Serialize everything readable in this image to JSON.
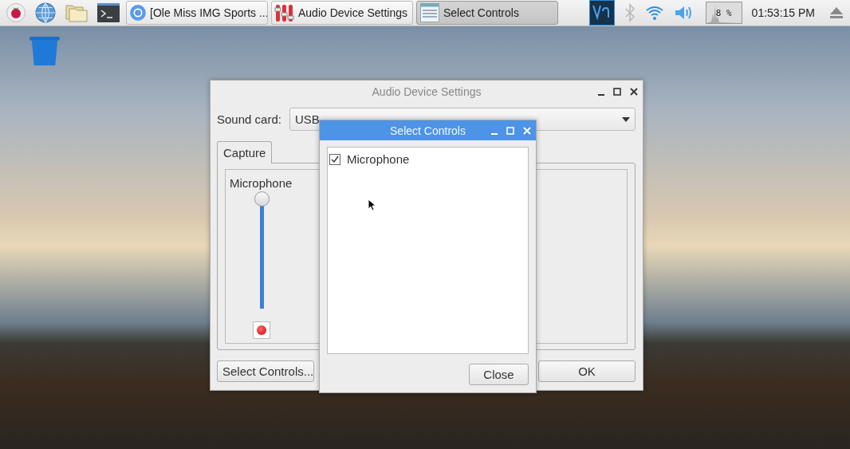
{
  "taskbar": {
    "launchers": [
      {
        "kind": "raspberry"
      },
      {
        "kind": "globe"
      },
      {
        "kind": "folder"
      },
      {
        "kind": "terminal"
      }
    ],
    "tasks": [
      {
        "kind": "browser",
        "label": "[Ole Miss IMG Sports ...",
        "selected": false
      },
      {
        "kind": "mixer",
        "label": "Audio Device Settings",
        "selected": false
      },
      {
        "kind": "controls",
        "label": "Select Controls",
        "selected": true
      }
    ],
    "cpu": "8 %",
    "clock": "01:53:15 PM"
  },
  "main_window": {
    "title": "Audio Device Settings",
    "sound_card_label": "Sound card:",
    "sound_card_value": "USB",
    "tabs": [
      {
        "label": "Capture",
        "selected": true
      }
    ],
    "channels": [
      {
        "name": "Microphone",
        "level": 1.0,
        "record": true
      }
    ],
    "buttons": [
      "Select Controls...",
      "OK"
    ]
  },
  "dialog": {
    "title": "Select Controls",
    "items": [
      {
        "label": "Microphone",
        "checked": true
      }
    ],
    "button": "Close"
  }
}
